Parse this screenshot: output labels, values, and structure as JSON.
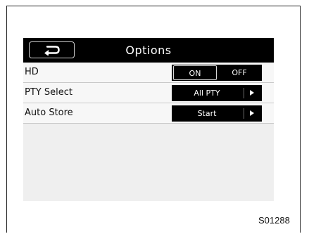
{
  "header": {
    "title": "Options",
    "back_icon": "return-arrow-icon"
  },
  "rows": {
    "hd": {
      "label": "HD",
      "on_label": "ON",
      "off_label": "OFF",
      "selected": "ON"
    },
    "pty": {
      "label": "PTY Select",
      "value": "All PTY",
      "icon": "triangle-right-icon"
    },
    "auto_store": {
      "label": "Auto Store",
      "value": "Start",
      "icon": "triangle-right-icon"
    }
  },
  "figure_code": "S01288",
  "colors": {
    "titlebar": "#000000",
    "control": "#000000",
    "screen_bg": "#efefef",
    "row_bg": "#f7f7f7"
  }
}
